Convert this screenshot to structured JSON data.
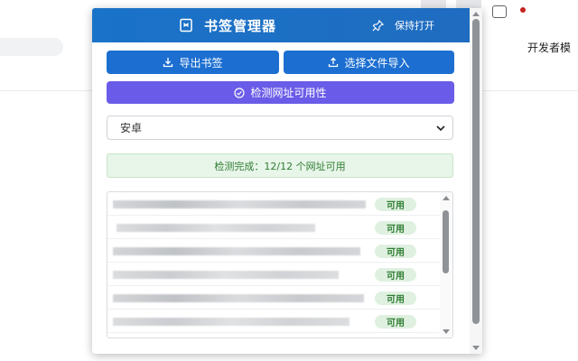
{
  "background": {
    "right_text": "开发者模"
  },
  "popup": {
    "title": "书签管理器",
    "pin_label": "保持打开",
    "buttons": {
      "export": "导出书签",
      "import": "选择文件导入",
      "check": "检测网址可用性"
    },
    "folder_select": {
      "selected": "安卓"
    },
    "status_text": "检测完成：12/12 个网址可用",
    "rows": [
      {
        "status": "可用"
      },
      {
        "status": "可用"
      },
      {
        "status": "可用"
      },
      {
        "status": "可用"
      },
      {
        "status": "可用"
      },
      {
        "status": "可用"
      }
    ]
  },
  "colors": {
    "header_blue": "#1a73c9",
    "button_blue": "#1c6fd1",
    "button_purple": "#6a5ce8",
    "status_green_bg": "#e8f5e9",
    "status_green_text": "#2e7d32"
  },
  "icons": [
    "bookmark-icon",
    "pin-icon",
    "download-icon",
    "upload-icon",
    "check-circle-icon",
    "chevron-down-icon"
  ]
}
